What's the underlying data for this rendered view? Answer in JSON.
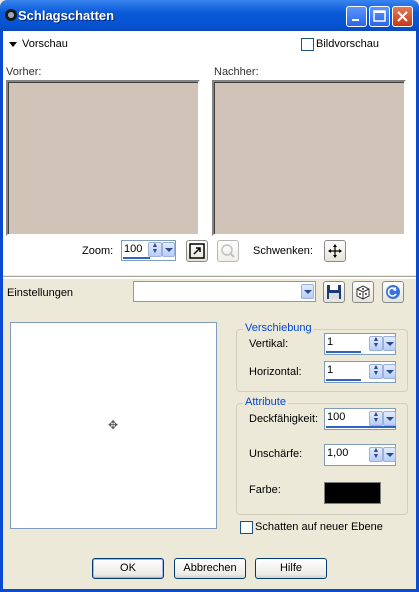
{
  "window": {
    "title": "Schlagschatten"
  },
  "preview": {
    "section_label": "Vorschau",
    "image_preview_label": "Bildvorschau",
    "before_label": "Vorher:",
    "after_label": "Nachher:",
    "zoom_label": "Zoom:",
    "zoom_value": "100",
    "pan_label": "Schwenken:"
  },
  "settings": {
    "label": "Einstellungen",
    "preset_value": ""
  },
  "offset": {
    "legend": "Verschiebung",
    "vertical_label": "Vertikal:",
    "vertical_value": "1",
    "horizontal_label": "Horizontal:",
    "horizontal_value": "1"
  },
  "attributes": {
    "legend": "Attribute",
    "opacity_label": "Deckfähigkeit:",
    "opacity_value": "100",
    "blur_label": "Unschärfe:",
    "blur_value": "1,00",
    "color_label": "Farbe:",
    "color_value": "#000000"
  },
  "shadow_new_layer_label": "Schatten auf neuer Ebene",
  "buttons": {
    "ok": "OK",
    "cancel": "Abbrechen",
    "help": "Hilfe"
  }
}
